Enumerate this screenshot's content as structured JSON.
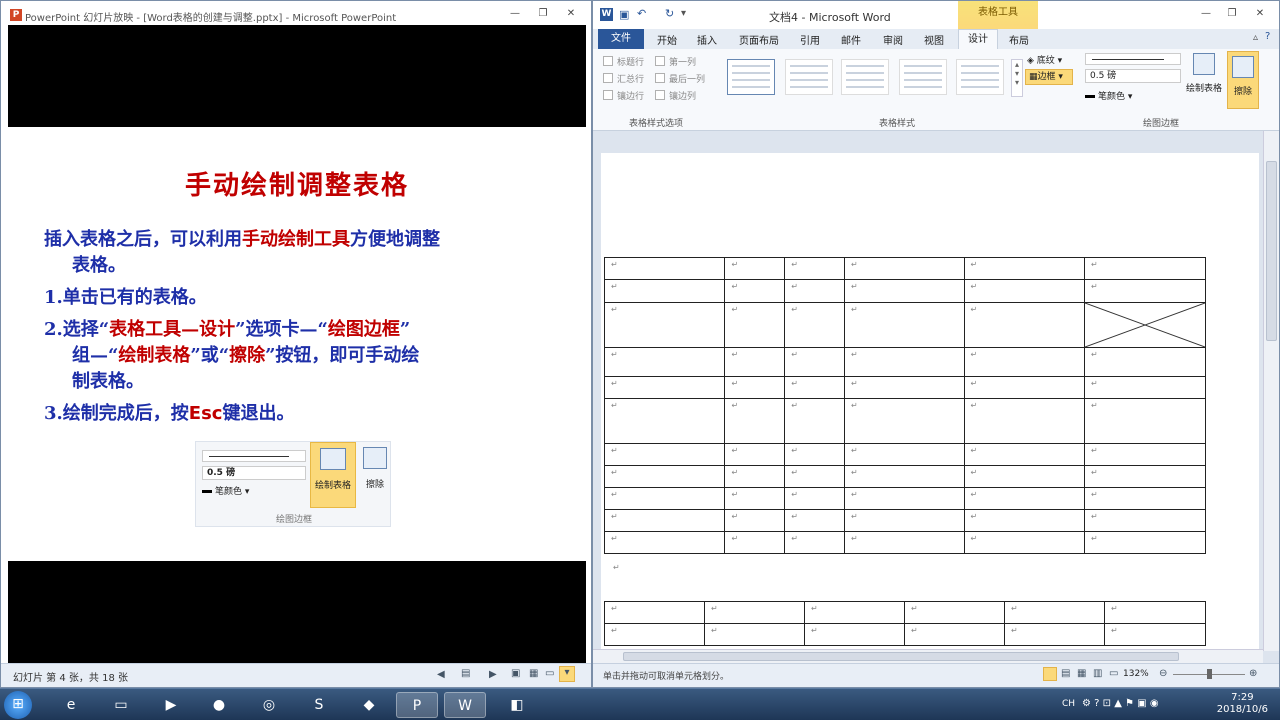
{
  "ppt": {
    "window_title": "PowerPoint 幻灯片放映 - [Word表格的创建与调整.pptx] - Microsoft PowerPoint",
    "slide": {
      "title": "手动绘制调整表格",
      "intro_a": "插入表格之后，可以利用",
      "intro_b": "手动绘制工具",
      "intro_c": "方便地调整",
      "intro_d": "表格。",
      "step1": "1.单击已有的表格。",
      "step2_a": "2.选择“",
      "step2_b": "表格工具—设计",
      "step2_c": "”选项卡—“",
      "step2_d": "绘图边框",
      "step2_e": "”",
      "step2_f": "组—“",
      "step2_g": "绘制表格",
      "step2_h": "”或“",
      "step2_i": "擦除",
      "step2_j": "”按钮，即可手动绘",
      "step2_k": "制表格。",
      "step3_a": "3.绘制完成后，按",
      "step3_b": "Esc",
      "step3_c": "键退出。",
      "mini": {
        "weight": "0.5 磅",
        "pen_color": "笔颜色",
        "draw_table": "绘制表格",
        "eraser": "擦除",
        "group": "绘图边框"
      }
    },
    "status": "幻灯片 第 4 张，共 18 张"
  },
  "word": {
    "title": "文档4 - Microsoft Word",
    "context_tab": "表格工具",
    "tabs": [
      "文件",
      "开始",
      "插入",
      "页面布局",
      "引用",
      "邮件",
      "审阅",
      "视图",
      "设计",
      "布局"
    ],
    "options": [
      "标题行",
      "第一列",
      "汇总行",
      "最后一列",
      "镶边行",
      "镶边列"
    ],
    "groups": [
      "表格样式选项",
      "表格样式",
      "绘图边框"
    ],
    "shading": "底纹",
    "borders": "边框",
    "weight": "0.5 磅",
    "pen_color": "笔颜色",
    "draw_table": "绘制表格",
    "eraser": "擦除",
    "mark": "↵",
    "status": "单击并拖动可取消单元格划分。",
    "zoom": "132%"
  },
  "taskbar": {
    "time": "7:29",
    "date": "2018/10/6",
    "lang": "CH"
  }
}
